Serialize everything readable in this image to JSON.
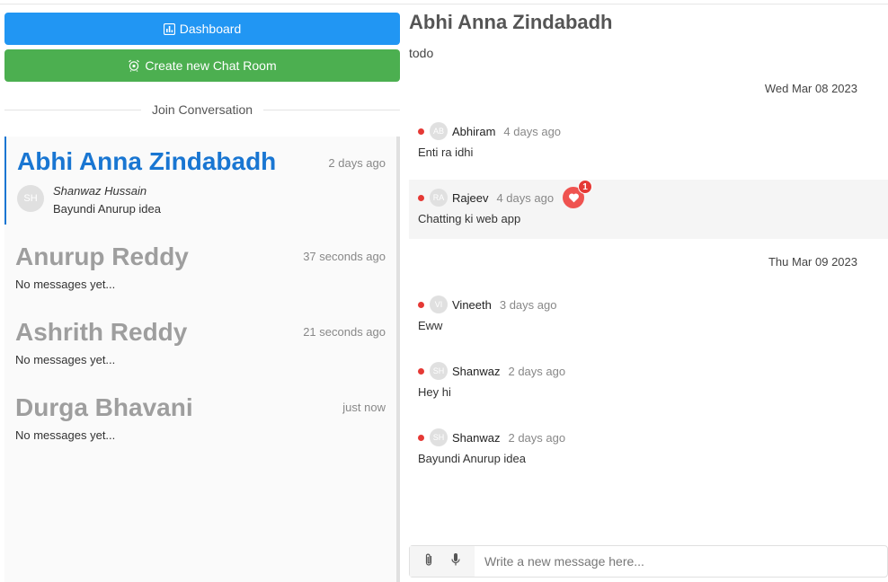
{
  "left": {
    "dashboard_label": "Dashboard",
    "create_label": "Create new Chat Room",
    "divider_label": "Join Conversation",
    "rooms": [
      {
        "name": "Abhi Anna Zindabadh",
        "time": "2 days ago",
        "avatar": "SH",
        "sender": "Shanwaz Hussain",
        "last": "Bayundi Anurup idea"
      },
      {
        "name": "Anurup Reddy",
        "time": "37 seconds ago",
        "preview": "No messages yet..."
      },
      {
        "name": "Ashrith Reddy",
        "time": "21 seconds ago",
        "preview": "No messages yet..."
      },
      {
        "name": "Durga Bhavani",
        "time": "just now",
        "preview": "No messages yet..."
      }
    ]
  },
  "chat": {
    "title": "Abhi Anna Zindabadh",
    "description": "todo",
    "dates": [
      "Wed Mar 08 2023",
      "Thu Mar 09 2023"
    ],
    "messages": [
      {
        "avatar": "AB",
        "user": "Abhiram",
        "ago": "4 days ago",
        "text": "Enti ra idhi"
      },
      {
        "avatar": "RA",
        "user": "Rajeev",
        "ago": "4 days ago",
        "text": "Chatting ki web app",
        "reaction_count": "1"
      },
      {
        "avatar": "VI",
        "user": "Vineeth",
        "ago": "3 days ago",
        "text": "Eww"
      },
      {
        "avatar": "SH",
        "user": "Shanwaz",
        "ago": "2 days ago",
        "text": "Hey hi"
      },
      {
        "avatar": "SH",
        "user": "Shanwaz",
        "ago": "2 days ago",
        "text": "Bayundi Anurup idea"
      }
    ],
    "composer_placeholder": "Write a new message here..."
  },
  "colors": {
    "primary": "#2196f3",
    "success": "#4caf50",
    "active": "#1976d2",
    "status_dot": "#e53935"
  }
}
